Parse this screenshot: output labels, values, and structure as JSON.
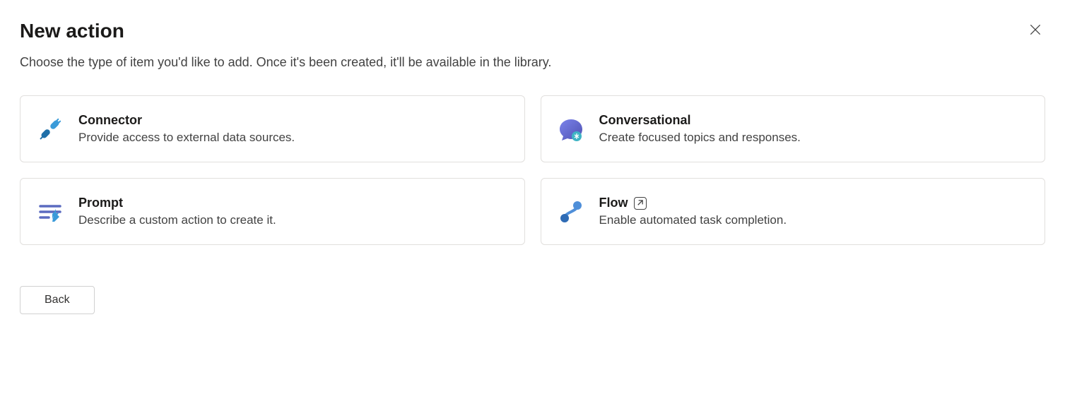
{
  "header": {
    "title": "New action",
    "subtitle": "Choose the type of item you'd like to add. Once it's been created, it'll be available in the library."
  },
  "cards": {
    "connector": {
      "title": "Connector",
      "desc": "Provide access to external data sources."
    },
    "conversational": {
      "title": "Conversational",
      "desc": "Create focused topics and responses."
    },
    "prompt": {
      "title": "Prompt",
      "desc": "Describe a custom action to create it."
    },
    "flow": {
      "title": "Flow",
      "desc": "Enable automated task completion."
    }
  },
  "footer": {
    "back_label": "Back"
  }
}
